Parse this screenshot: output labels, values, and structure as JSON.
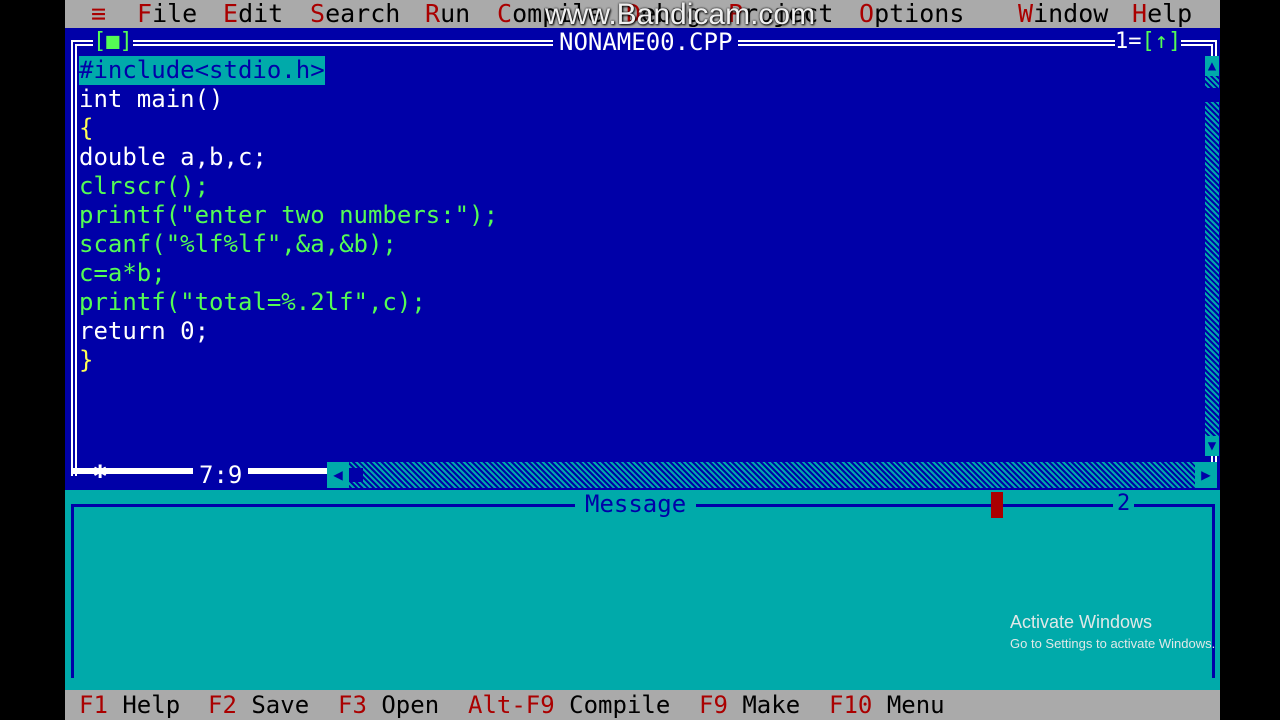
{
  "menu": {
    "system": "≡",
    "items": [
      {
        "hot": "F",
        "rest": "ile"
      },
      {
        "hot": "E",
        "rest": "dit"
      },
      {
        "hot": "S",
        "rest": "earch"
      },
      {
        "hot": "R",
        "rest": "un"
      },
      {
        "hot": "C",
        "rest": "ompile"
      },
      {
        "hot": "D",
        "rest": "ebug"
      },
      {
        "hot": "P",
        "rest": "roject"
      },
      {
        "hot": "O",
        "rest": "ptions"
      },
      {
        "hot": "W",
        "rest": "indow"
      },
      {
        "hot": "H",
        "rest": "elp"
      }
    ]
  },
  "watermark": "www.Bandicam.com",
  "editor": {
    "close_box": "[■]",
    "title": "NONAME00.CPP",
    "window_number": "1",
    "zoom_box": "[↑]",
    "cursor_position": "7:9",
    "lines": [
      "#include<stdio.h>",
      "int main()",
      "{",
      "double a,b,c;",
      "clrscr();",
      "printf(\"enter two numbers:\");",
      "scanf(\"%lf%lf\",&a,&b);",
      "c=a*b;",
      "printf(\"total=%.2lf\",c);",
      "return 0;",
      "}"
    ]
  },
  "message": {
    "title": "Message",
    "number": "2"
  },
  "activation": {
    "line1": "Activate Windows",
    "line2": "Go to Settings to activate Windows."
  },
  "fkeys": [
    {
      "key": "F1",
      "label": "Help"
    },
    {
      "key": "F2",
      "label": "Save"
    },
    {
      "key": "F3",
      "label": "Open"
    },
    {
      "key": "Alt-F9",
      "label": "Compile"
    },
    {
      "key": "F9",
      "label": "Make"
    },
    {
      "key": "F10",
      "label": "Menu"
    }
  ],
  "colors": {
    "editor_bg": "#0000a8",
    "menu_bg": "#aaaaaa",
    "hotkey": "#aa0000",
    "message_bg": "#00aaaa",
    "code_text": "#ffff54"
  }
}
